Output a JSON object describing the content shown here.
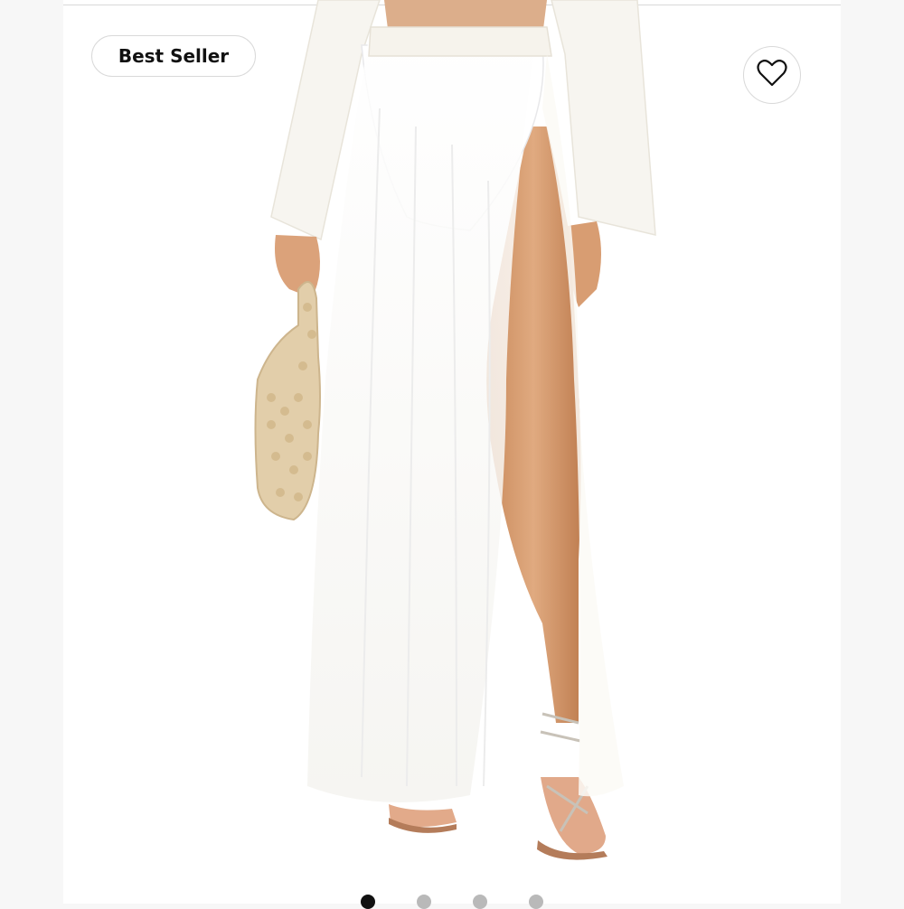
{
  "product": {
    "badge": "Best Seller",
    "favorite_icon": "heart-outline-icon"
  },
  "carousel": {
    "total_slides": 4,
    "active_index": 0
  },
  "colors": {
    "badge_border": "#d9d9d9",
    "dot_active": "#111111",
    "dot_inactive": "#b9b9b9"
  }
}
